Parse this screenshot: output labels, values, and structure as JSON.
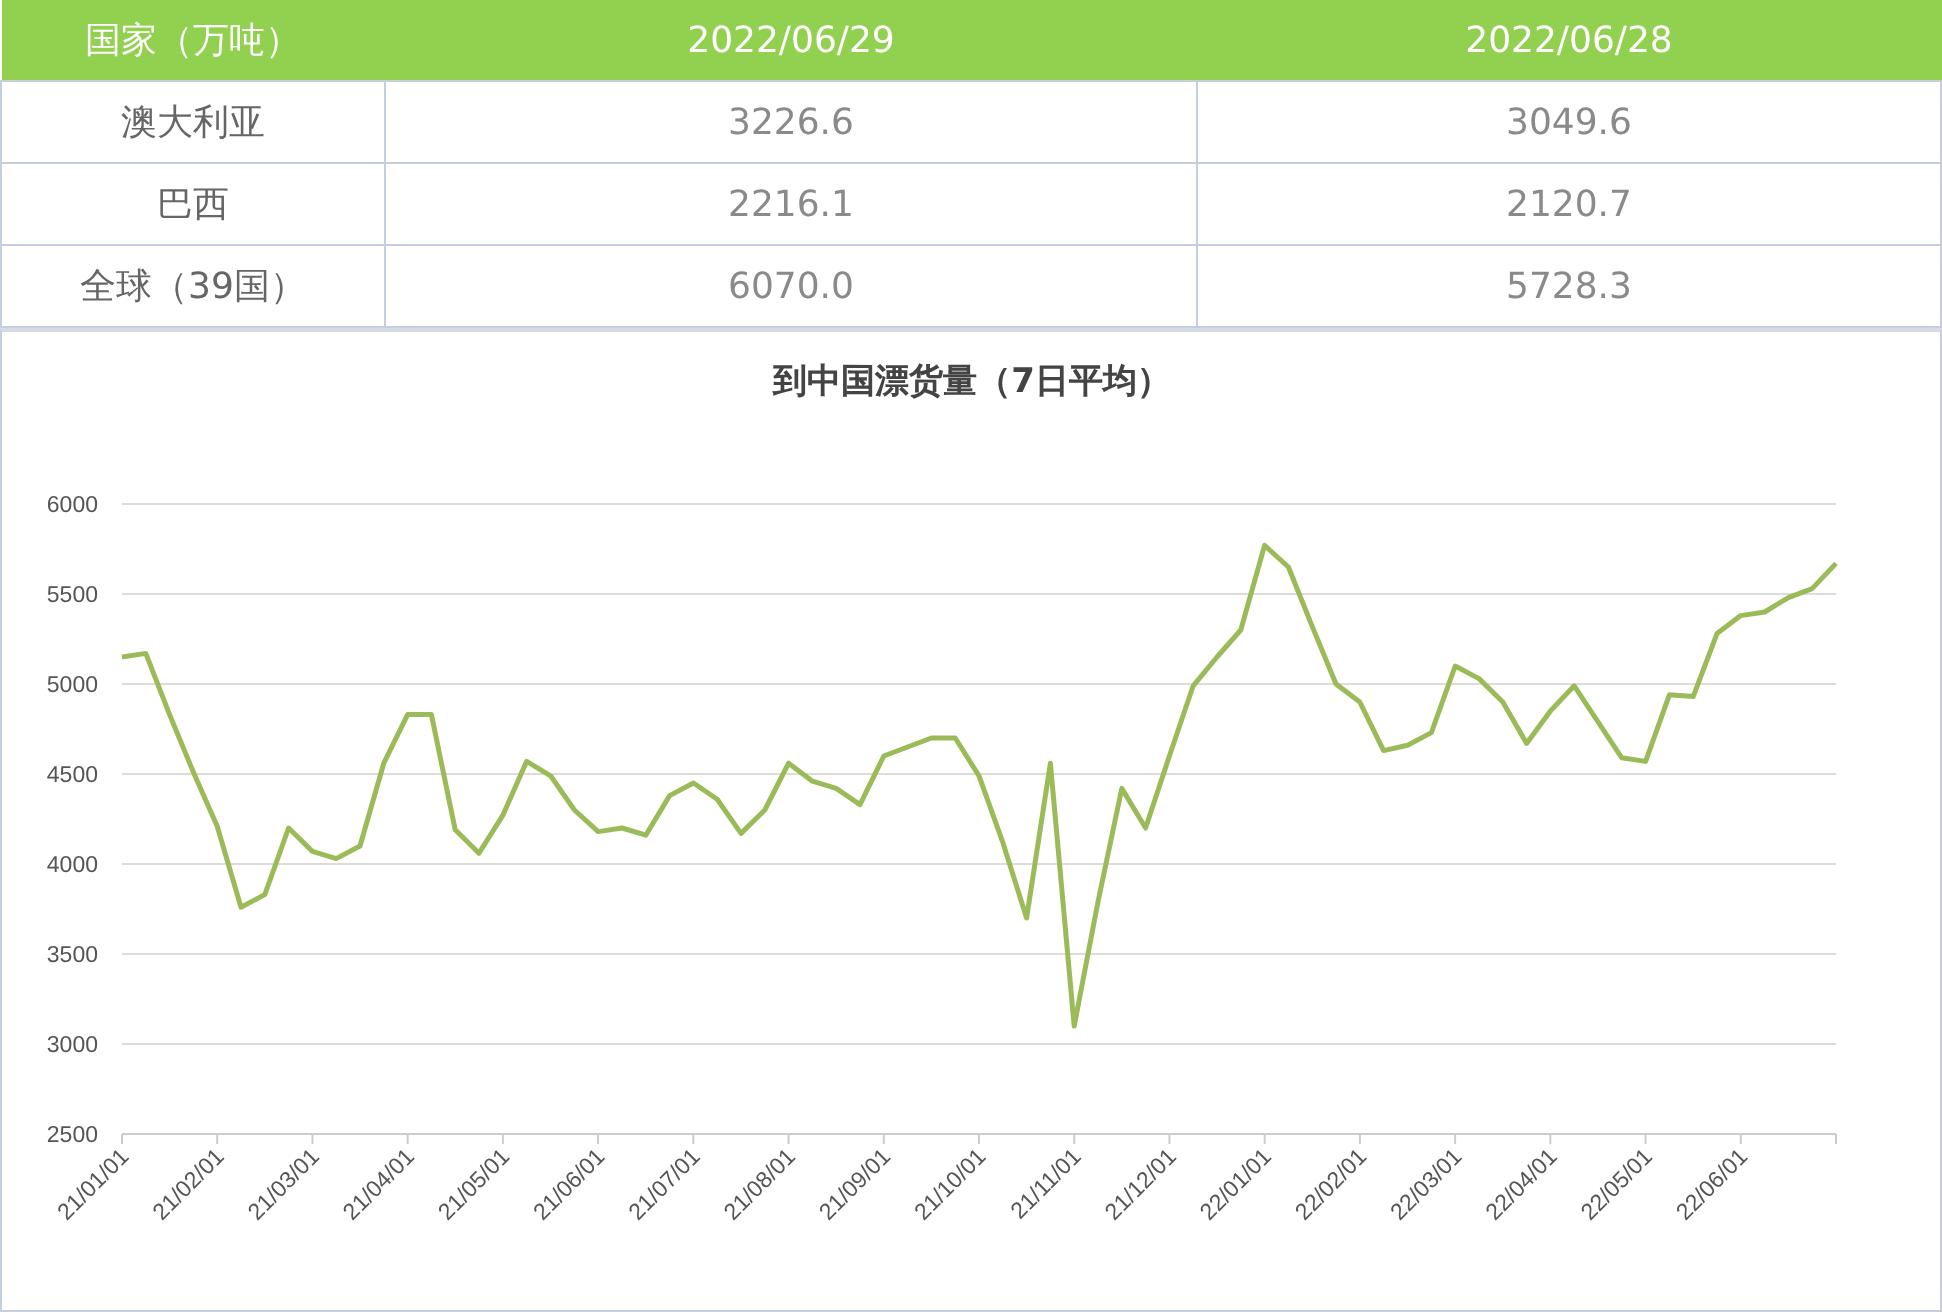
{
  "table": {
    "columns": [
      "国家（万吨）",
      "2022/06/29",
      "2022/06/28"
    ],
    "rows": [
      [
        "澳大利亚",
        "3226.6",
        "3049.6"
      ],
      [
        "巴西",
        "2216.1",
        "2120.7"
      ],
      [
        "全球（39国）",
        "6070.0",
        "5728.3"
      ]
    ]
  },
  "chart": {
    "chart_data": {
      "type": "line",
      "title": "到中国漂货量（7日平均）",
      "categories": [
        "21/01/01",
        null,
        null,
        null,
        "21/02/01",
        null,
        null,
        null,
        "21/03/01",
        null,
        null,
        null,
        "21/04/01",
        null,
        null,
        null,
        "21/05/01",
        null,
        null,
        null,
        "21/06/01",
        null,
        null,
        null,
        "21/07/01",
        null,
        null,
        null,
        "21/08/01",
        null,
        null,
        null,
        "21/09/01",
        null,
        null,
        null,
        "21/10/01",
        null,
        null,
        null,
        "21/11/01",
        null,
        null,
        null,
        "21/12/01",
        null,
        null,
        null,
        "22/01/01",
        null,
        null,
        null,
        "22/02/01",
        null,
        null,
        null,
        "22/03/01",
        null,
        null,
        null,
        "22/04/01",
        null,
        null,
        null,
        "22/05/01",
        null,
        null,
        null,
        "22/06/01",
        null,
        null,
        null,
        null
      ],
      "series": [
        {
          "color": "#9bbb59",
          "values": [
            5150,
            5170,
            4830,
            4510,
            4210,
            3760,
            3830,
            4200,
            4070,
            4030,
            4100,
            4560,
            4830,
            4830,
            4190,
            4060,
            4270,
            4570,
            4490,
            4300,
            4180,
            4200,
            4160,
            4380,
            4450,
            4360,
            4170,
            4300,
            4560,
            4460,
            4420,
            4330,
            4600,
            4650,
            4700,
            4700,
            4490,
            4120,
            3700,
            4560,
            3100,
            3790,
            4420,
            4200,
            4600,
            4990,
            5150,
            5300,
            5770,
            5650,
            5320,
            5000,
            4900,
            4630,
            4660,
            4730,
            5100,
            5030,
            4900,
            4670,
            4850,
            4990,
            4790,
            4590,
            4570,
            4940,
            4930,
            5280,
            5380,
            5400,
            5480,
            5530,
            5670
          ]
        }
      ],
      "grid": true,
      "ylim": [
        2500,
        6000
      ],
      "yticks": [
        2500,
        3000,
        3500,
        4000,
        4500,
        5000,
        5500,
        6000
      ]
    }
  }
}
